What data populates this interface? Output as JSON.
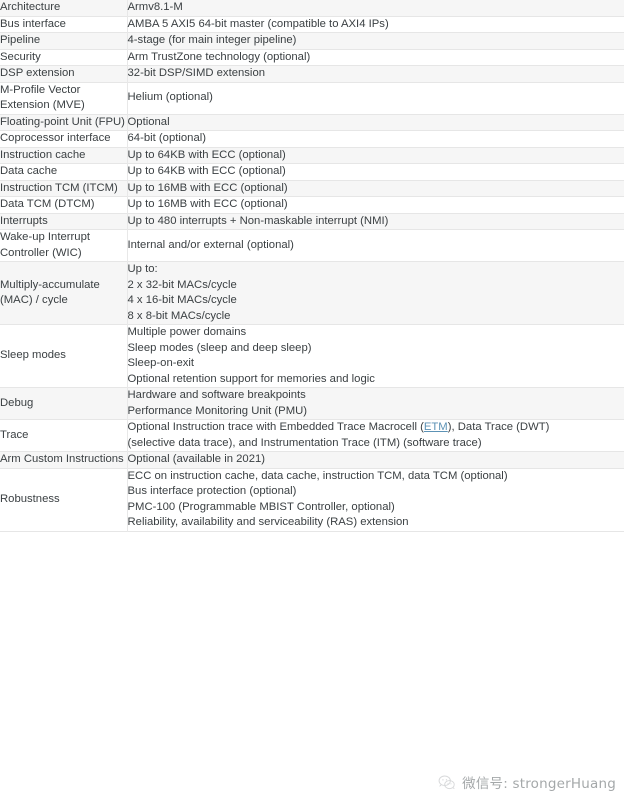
{
  "table": {
    "rows": [
      {
        "label": "Architecture",
        "value_lines": [
          "Armv8.1-M"
        ]
      },
      {
        "label": "Bus interface",
        "value_lines": [
          "AMBA 5 AXI5 64-bit master (compatible to AXI4 IPs)"
        ]
      },
      {
        "label": "Pipeline",
        "value_lines": [
          "4-stage (for main integer pipeline)"
        ]
      },
      {
        "label": "Security",
        "value_lines": [
          "Arm TrustZone technology (optional)"
        ]
      },
      {
        "label": "DSP extension",
        "value_lines": [
          "32-bit DSP/SIMD extension"
        ]
      },
      {
        "label": "M-Profile Vector Extension (MVE)",
        "value_lines": [
          "Helium (optional)"
        ]
      },
      {
        "label": "Floating-point Unit (FPU)",
        "value_lines": [
          "Optional"
        ]
      },
      {
        "label": "Coprocessor interface",
        "value_lines": [
          "64-bit (optional)"
        ]
      },
      {
        "label": "Instruction cache",
        "value_lines": [
          "Up to 64KB with ECC (optional)"
        ]
      },
      {
        "label": "Data cache",
        "value_lines": [
          "Up to 64KB with ECC (optional)"
        ]
      },
      {
        "label": "Instruction TCM (ITCM)",
        "value_lines": [
          "Up to 16MB with ECC (optional)"
        ]
      },
      {
        "label": "Data TCM (DTCM)",
        "value_lines": [
          "Up to 16MB with ECC (optional)"
        ]
      },
      {
        "label": "Interrupts",
        "value_lines": [
          "Up to 480 interrupts + Non-maskable interrupt (NMI)"
        ]
      },
      {
        "label": "Wake-up Interrupt Controller (WIC)",
        "value_lines": [
          "Internal and/or external (optional)"
        ]
      },
      {
        "label": "Multiply-accumulate (MAC) / cycle",
        "value_lines": [
          "Up to:",
          "2 x 32-bit MACs/cycle",
          "4 x 16-bit MACs/cycle",
          "8 x 8-bit MACs/cycle"
        ]
      },
      {
        "label": "Sleep modes",
        "value_lines": [
          "Multiple power domains",
          "Sleep modes (sleep and deep sleep)",
          "Sleep-on-exit",
          "Optional retention support for memories and logic"
        ]
      },
      {
        "label": "Debug",
        "value_lines": [
          "Hardware and software breakpoints",
          "Performance Monitoring Unit (PMU)"
        ]
      },
      {
        "label": "Trace",
        "value_lines": [
          "Optional Instruction trace with Embedded Trace Macrocell (ETM), Data Trace (DWT)",
          "(selective data trace), and Instrumentation Trace (ITM) (software trace)"
        ],
        "link_text": "ETM"
      },
      {
        "label": "Arm Custom Instructions",
        "value_lines": [
          "Optional (available in 2021)"
        ]
      },
      {
        "label": "Robustness",
        "value_lines": [
          "ECC on instruction cache, data cache, instruction TCM, data TCM (optional)",
          "Bus interface protection (optional)",
          "PMC-100 (Programmable MBIST Controller, optional)",
          "Reliability, availability and serviceability (RAS) extension"
        ]
      }
    ]
  },
  "watermark": {
    "text": "微信号: strongerHuang",
    "icon": "wechat-logo-icon"
  },
  "colors": {
    "row_alt_background": "#f6f6f6",
    "row_background": "#ffffff",
    "row_divider": "#e6e6e6",
    "text": "#3b4043",
    "link": "#5c92b5",
    "watermark_text": "#6e7376"
  }
}
